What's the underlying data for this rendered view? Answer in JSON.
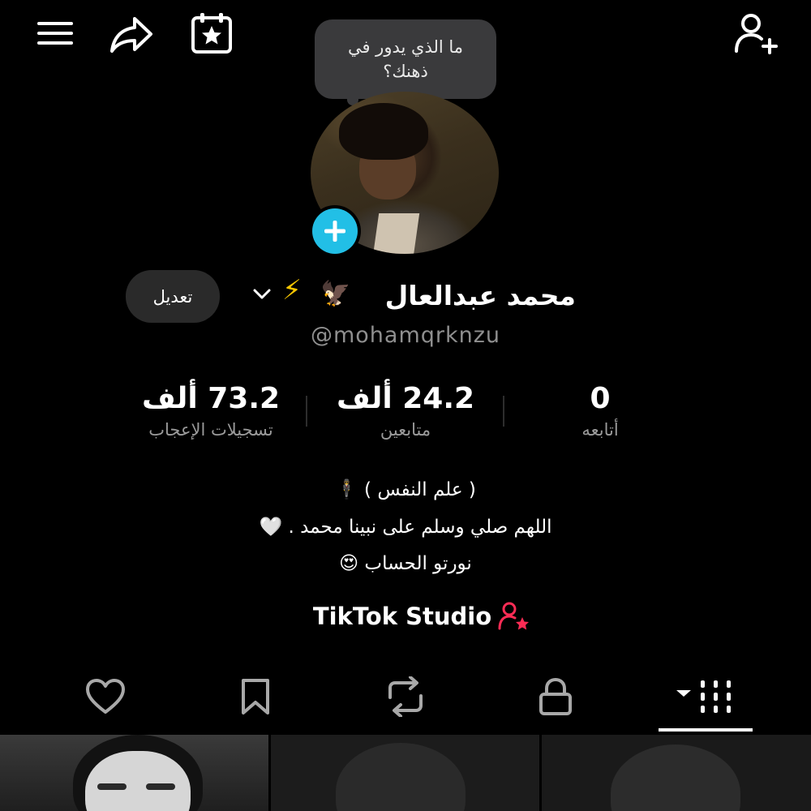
{
  "topbar": {
    "menu_icon": "menu-icon",
    "share_icon": "share-icon",
    "calendar_icon": "calendar-star-icon",
    "add_friend_icon": "add-user-icon"
  },
  "note_bubble": {
    "text": "ما الذي يدور في ذهنك؟"
  },
  "profile": {
    "name": "محمد عبدالعال",
    "emojis": "⚡",
    "eagle": "🦅",
    "username": "@mohamqrknzu",
    "edit_label": "تعديل"
  },
  "stats": [
    {
      "value": "0",
      "label": "أتابعه"
    },
    {
      "value": "24.2 ألف",
      "label": "متابعين"
    },
    {
      "value": "73.2 ألف",
      "label": "تسجيلات الإعجاب"
    }
  ],
  "bio": {
    "line1": "( علم النفس ) 🕴",
    "line2": "اللهم صلي وسلم على نبينا محمد . 🤍",
    "line3": "نورتو الحساب 😍"
  },
  "studio": {
    "label": "TikTok Studio",
    "accent": "#fe2c55"
  },
  "tabs": [
    {
      "name": "liked",
      "icon": "heart-icon"
    },
    {
      "name": "favorites",
      "icon": "bookmark-icon"
    },
    {
      "name": "reposts",
      "icon": "repost-icon"
    },
    {
      "name": "private",
      "icon": "lock-icon"
    },
    {
      "name": "videos",
      "icon": "grid-icon",
      "active": true
    }
  ],
  "colors": {
    "background": "#000000",
    "accent_blue": "#22bfe6",
    "muted": "#9a9a9a"
  }
}
